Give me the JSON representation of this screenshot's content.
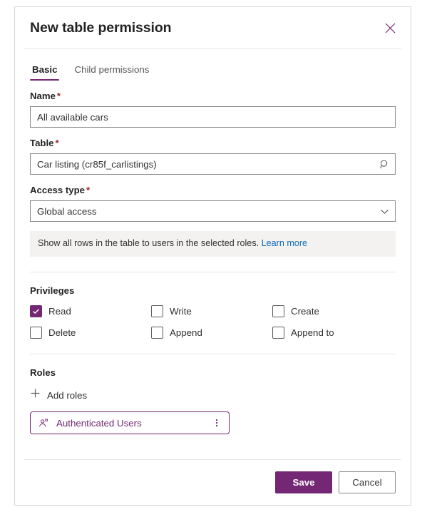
{
  "dialog": {
    "title": "New table permission",
    "close_icon": "close-icon"
  },
  "tabs": [
    {
      "label": "Basic",
      "active": true
    },
    {
      "label": "Child permissions",
      "active": false
    }
  ],
  "fields": {
    "name": {
      "label": "Name",
      "required_marker": "*",
      "value": "All available cars",
      "placeholder": ""
    },
    "table": {
      "label": "Table",
      "required_marker": "*",
      "value": "Car listing (cr85f_carlistings)",
      "placeholder": "",
      "icon": "search-icon"
    },
    "access_type": {
      "label": "Access type",
      "required_marker": "*",
      "value": "Global access",
      "placeholder": "",
      "icon": "chevron-down-icon"
    }
  },
  "hint": {
    "text": "Show all rows in the table to users in the selected roles.",
    "link_label": "Learn more"
  },
  "privileges": {
    "title": "Privileges",
    "items": [
      {
        "label": "Read",
        "checked": true
      },
      {
        "label": "Write",
        "checked": false
      },
      {
        "label": "Create",
        "checked": false
      },
      {
        "label": "Delete",
        "checked": false
      },
      {
        "label": "Append",
        "checked": false
      },
      {
        "label": "Append to",
        "checked": false
      }
    ]
  },
  "roles": {
    "title": "Roles",
    "add_label": "Add roles",
    "add_icon": "plus-icon",
    "items": [
      {
        "label": "Authenticated Users",
        "icon": "person-icon",
        "menu_icon": "more-vertical-icon"
      }
    ]
  },
  "footer": {
    "save_label": "Save",
    "cancel_label": "Cancel"
  },
  "colors": {
    "accent": "#742774",
    "link": "#0f6cbd",
    "required": "#a4262c",
    "hint_background": "#f3f2f1",
    "border": "#8a8886"
  }
}
